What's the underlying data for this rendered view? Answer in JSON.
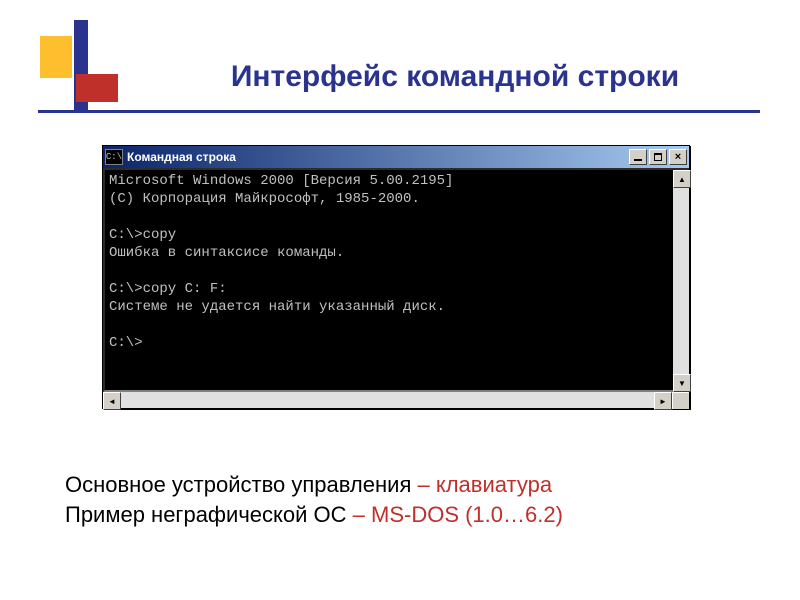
{
  "slide": {
    "title": "Интерфейс командной строки"
  },
  "window": {
    "icon_text": "C:\\",
    "title": "Командная строка",
    "buttons": {
      "minimize": "minimize",
      "maximize": "maximize",
      "close": "close"
    },
    "console_lines": [
      "Microsoft Windows 2000 [Версия 5.00.2195]",
      "(С) Корпорация Майкрософт, 1985-2000.",
      "",
      "C:\\>copy",
      "Ошибка в синтаксисе команды.",
      "",
      "C:\\>copy C: F:",
      "Системе не удается найти указанный диск.",
      "",
      "C:\\>"
    ]
  },
  "caption": {
    "line1_black": "Основное устройство управления ",
    "line1_red": "– клавиатура",
    "line2_black": "Пример неграфической ОС ",
    "line2_red": "– MS-DOS (1.0…6.2)"
  }
}
